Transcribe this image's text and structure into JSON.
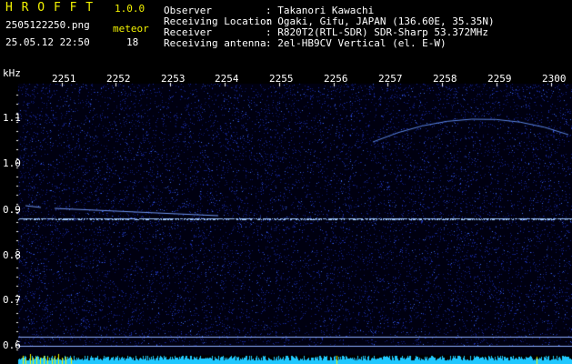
{
  "header": {
    "app_name": "H R O F F T",
    "version": "1.0.0",
    "filename": "2505122250.png",
    "datetime": "25.05.12 22:50",
    "count_label": "meteor",
    "count_value": "18",
    "info": [
      {
        "label": "Observer",
        "value": ": Takanori Kawachi"
      },
      {
        "label": "Receiving Location",
        "value": ": Ogaki, Gifu, JAPAN (136.60E, 35.35N)"
      },
      {
        "label": "Receiver",
        "value": ": R820T2(RTL-SDR) SDR-Sharp 53.372MHz"
      },
      {
        "label": "Receiving antenna",
        "value": ": 2el-HB9CV Vertical (el. E-W)"
      }
    ]
  },
  "spectrogram": {
    "unit_label": "kHz",
    "time_ticks": [
      "2251",
      "2252",
      "2253",
      "2254",
      "2255",
      "2256",
      "2257",
      "2258",
      "2259",
      "2300"
    ],
    "freq_ticks": [
      "1.1",
      "1.0",
      "0.9",
      "0.8",
      "0.7",
      "0.6"
    ],
    "colors": {
      "background": "#000010",
      "noise": "#1c2ea8",
      "carrier": "#9fc8ff",
      "bottom_band": "#20c8ff",
      "yellow": "#f2f200"
    }
  }
}
